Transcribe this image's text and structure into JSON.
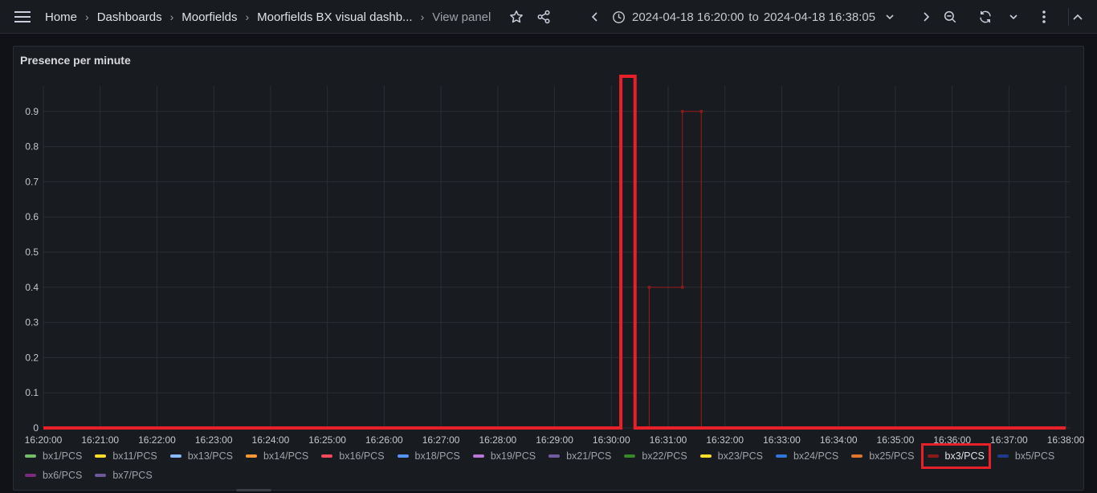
{
  "header": {
    "breadcrumbs": [
      "Home",
      "Dashboards",
      "Moorfields",
      "Moorfields BX visual dashb...",
      "View panel"
    ],
    "time_from": "2024-04-18 16:20:00",
    "time_to_word": "to",
    "time_to": "2024-04-18 16:38:05",
    "icons": {
      "menu": "hamburger-menu-icon",
      "star": "star-icon",
      "share": "share-icon",
      "prev": "chevron-left-icon",
      "clock": "clock-icon",
      "dropdown": "chevron-down-icon",
      "next": "chevron-right-icon",
      "zoom": "zoom-out-icon",
      "refresh": "refresh-icon",
      "more": "kebab-menu-icon",
      "collapse": "chevron-up-icon"
    }
  },
  "panel": {
    "title": "Presence per minute"
  },
  "chart_data": {
    "type": "line",
    "title": "Presence per minute",
    "x_ticks": [
      "16:20:00",
      "16:21:00",
      "16:22:00",
      "16:23:00",
      "16:24:00",
      "16:25:00",
      "16:26:00",
      "16:27:00",
      "16:28:00",
      "16:29:00",
      "16:30:00",
      "16:31:00",
      "16:32:00",
      "16:33:00",
      "16:34:00",
      "16:35:00",
      "16:36:00",
      "16:37:00",
      "16:38:00"
    ],
    "y_ticks": [
      "0",
      "0.1",
      "0.2",
      "0.3",
      "0.4",
      "0.5",
      "0.6",
      "0.7",
      "0.8",
      "0.9"
    ],
    "ylim": [
      0,
      1
    ],
    "xlim": [
      "16:20:00",
      "16:38:05"
    ],
    "grid": true,
    "legend_placement": "bottom",
    "series": [
      {
        "name": "bx3/PCS",
        "color": "#8b1a1a",
        "step": true,
        "points": [
          [
            "16:30:40",
            0
          ],
          [
            "16:30:40",
            0.4
          ],
          [
            "16:31:15",
            0.4
          ],
          [
            "16:31:15",
            0.9
          ],
          [
            "16:31:35",
            0.9
          ],
          [
            "16:31:35",
            0
          ]
        ]
      }
    ],
    "annotation": {
      "color": "#e8202a",
      "points": [
        [
          "16:20:00",
          0
        ],
        [
          "16:30:10",
          0
        ],
        [
          "16:30:10",
          1
        ],
        [
          "16:30:25",
          1
        ],
        [
          "16:30:25",
          0
        ],
        [
          "16:38:00",
          0
        ]
      ]
    }
  },
  "legend": [
    {
      "name": "bx1/PCS",
      "color": "#73bf69"
    },
    {
      "name": "bx11/PCS",
      "color": "#fade2a"
    },
    {
      "name": "bx13/PCS",
      "color": "#8ab8ff"
    },
    {
      "name": "bx14/PCS",
      "color": "#ff9830"
    },
    {
      "name": "bx16/PCS",
      "color": "#f2495c"
    },
    {
      "name": "bx18/PCS",
      "color": "#5794f2"
    },
    {
      "name": "bx19/PCS",
      "color": "#b877d9"
    },
    {
      "name": "bx21/PCS",
      "color": "#705da0"
    },
    {
      "name": "bx22/PCS",
      "color": "#37872d"
    },
    {
      "name": "bx23/PCS",
      "color": "#fade2a"
    },
    {
      "name": "bx24/PCS",
      "color": "#3274d9"
    },
    {
      "name": "bx25/PCS",
      "color": "#e0752d"
    },
    {
      "name": "bx3/PCS",
      "color": "#8b1a1a",
      "highlight": true
    },
    {
      "name": "bx5/PCS",
      "color": "#1f3a8a"
    },
    {
      "name": "bx6/PCS",
      "color": "#7b2a7e"
    },
    {
      "name": "bx7/PCS",
      "color": "#6e5a9a"
    }
  ]
}
